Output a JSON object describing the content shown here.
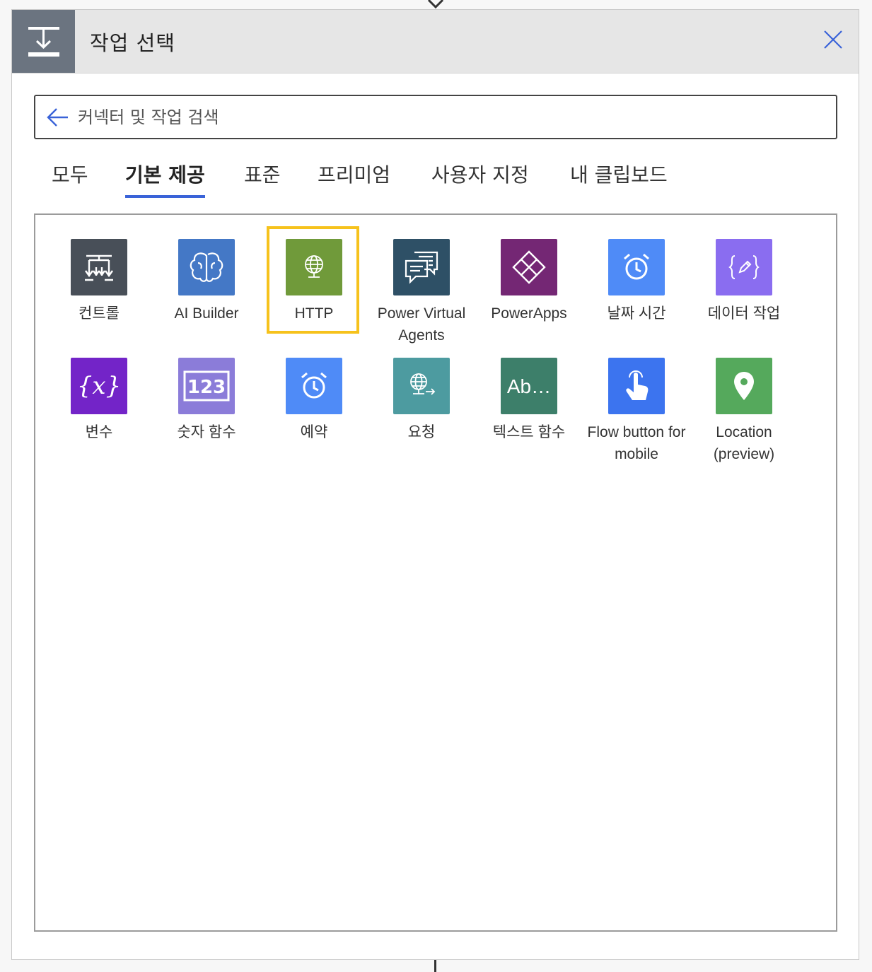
{
  "header": {
    "title": "작업 선택",
    "icon": "action-icon",
    "close_icon": "close-icon"
  },
  "search": {
    "placeholder": "커넥터 및 작업 검색",
    "value": "",
    "back_icon": "back-arrow-icon"
  },
  "tabs": [
    {
      "label": "모두",
      "active": false
    },
    {
      "label": "기본 제공",
      "active": true
    },
    {
      "label": "표준",
      "active": false
    },
    {
      "label": "프리미엄",
      "active": false
    },
    {
      "label": "사용자 지정",
      "active": false
    },
    {
      "label": "내 클립보드",
      "active": false
    }
  ],
  "connectors": [
    {
      "label": "컨트롤",
      "icon": "control-icon",
      "color": "#484f58"
    },
    {
      "label": "AI Builder",
      "icon": "brain-icon",
      "color": "#4478c6"
    },
    {
      "label": "HTTP",
      "icon": "globe-icon",
      "color": "#709a3a",
      "highlighted": true
    },
    {
      "label": "Power Virtual Agents",
      "icon": "chat-bubbles-icon",
      "color": "#2e5066"
    },
    {
      "label": "PowerApps",
      "icon": "powerapps-icon",
      "color": "#742774"
    },
    {
      "label": "날짜 시간",
      "icon": "alarm-clock-icon",
      "color": "#4f8bf7"
    },
    {
      "label": "데이터 작업",
      "icon": "curly-braces-edit-icon",
      "color": "#8a6df0"
    },
    {
      "label": "변수",
      "icon": "variable-icon",
      "color": "#7324c8"
    },
    {
      "label": "숫자 함수",
      "icon": "number-123-icon",
      "color": "#8b7cd9"
    },
    {
      "label": "예약",
      "icon": "alarm-clock-icon",
      "color": "#4f8bf7"
    },
    {
      "label": "요청",
      "icon": "globe-request-icon",
      "color": "#4d9ba0"
    },
    {
      "label": "텍스트 함수",
      "icon": "text-ab-icon",
      "color": "#3d7f6a"
    },
    {
      "label": "Flow button for mobile",
      "icon": "touch-hand-icon",
      "color": "#3c74ef"
    },
    {
      "label": "Location (preview)",
      "icon": "map-pin-icon",
      "color": "#55a95c"
    }
  ]
}
